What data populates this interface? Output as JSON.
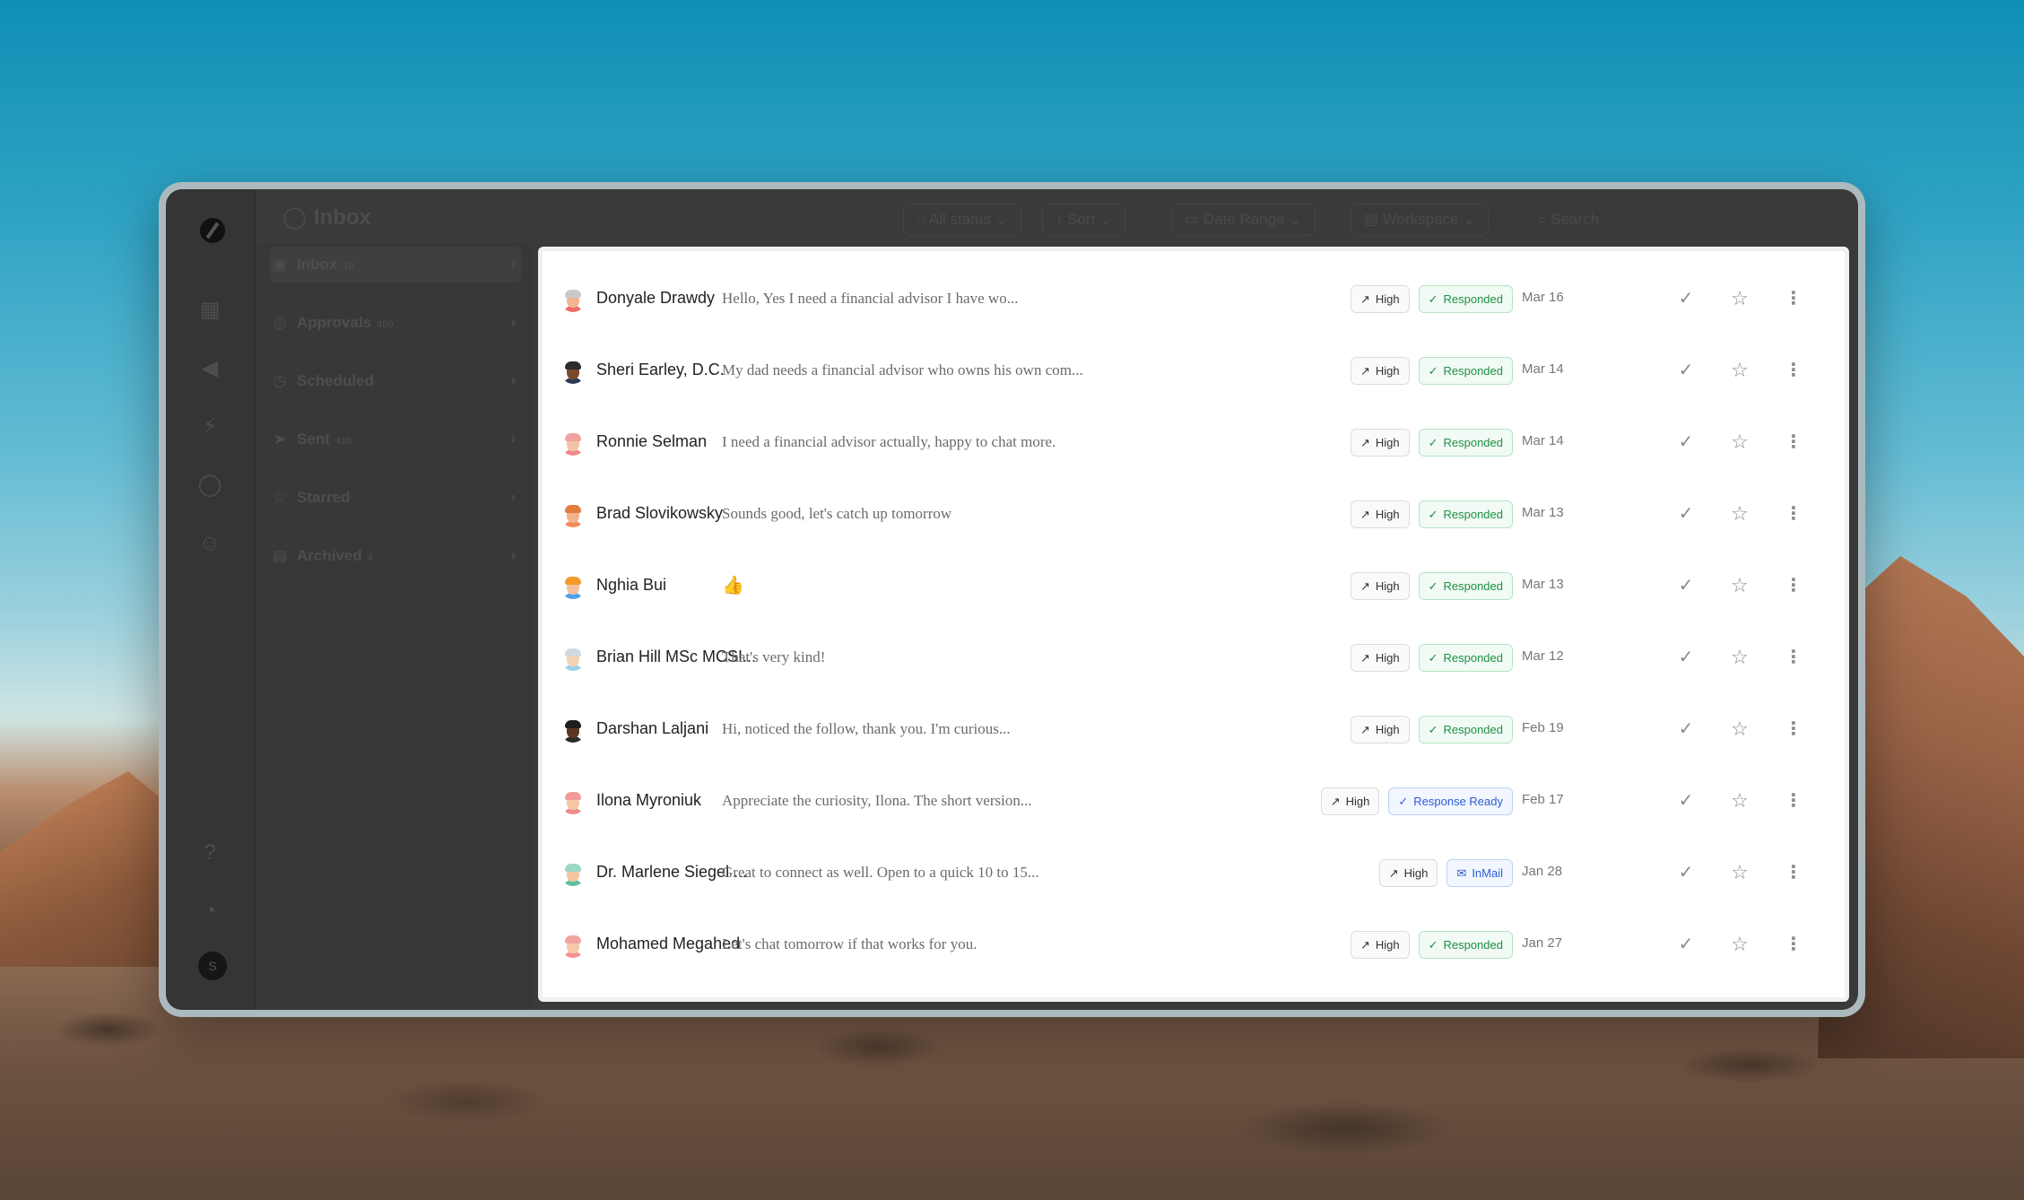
{
  "app": {
    "title": "Inbox"
  },
  "toolbar": {
    "status_filter": "All status",
    "sort_label": "Sort",
    "date_range_label": "Date Range",
    "workspace_label": "Workspace",
    "search_placeholder": "Search"
  },
  "sidebar": {
    "items": [
      {
        "label": "Inbox",
        "count": "10",
        "icon": "inbox-icon"
      },
      {
        "label": "Approvals",
        "count": "450",
        "icon": "approvals-icon"
      },
      {
        "label": "Scheduled",
        "count": "",
        "icon": "clock-icon"
      },
      {
        "label": "Sent",
        "count": "418",
        "icon": "send-icon"
      },
      {
        "label": "Starred",
        "count": "",
        "icon": "star-icon"
      },
      {
        "label": "Archived",
        "count": "4",
        "icon": "archive-icon"
      }
    ]
  },
  "rail": {
    "avatar_initial": "S"
  },
  "messages": [
    {
      "name": "Donyale Drawdy",
      "snippet": "Hello, Yes I need a financial advisor I have wo...",
      "priority": "High",
      "status": "Responded",
      "status_type": "ok",
      "date": "Mar 16"
    },
    {
      "name": "Sheri Earley, D.C.",
      "snippet": "My dad needs a financial advisor who owns his own com...",
      "priority": "High",
      "status": "Responded",
      "status_type": "ok",
      "date": "Mar 14"
    },
    {
      "name": "Ronnie Selman",
      "snippet": "I need a financial advisor actually, happy to chat more.",
      "priority": "High",
      "status": "Responded",
      "status_type": "ok",
      "date": "Mar 14"
    },
    {
      "name": "Brad Slovikowsky",
      "snippet": "Sounds good, let's catch up tomorrow",
      "priority": "High",
      "status": "Responded",
      "status_type": "ok",
      "date": "Mar 13"
    },
    {
      "name": "Nghia Bui",
      "snippet": "👍",
      "priority": "High",
      "status": "Responded",
      "status_type": "ok",
      "date": "Mar 13"
    },
    {
      "name": "Brian Hill MSc MCSI...",
      "snippet": "That's very kind!",
      "priority": "High",
      "status": "Responded",
      "status_type": "ok",
      "date": "Mar 12"
    },
    {
      "name": "Darshan Laljani",
      "snippet": "Hi, noticed the follow, thank you. I'm curious...",
      "priority": "High",
      "status": "Responded",
      "status_type": "ok",
      "date": "Feb 19"
    },
    {
      "name": "Ilona Myroniuk",
      "snippet": "Appreciate the curiosity, Ilona. The short version...",
      "priority": "High",
      "status": "Response Ready",
      "status_type": "ready",
      "date": "Feb 17"
    },
    {
      "name": "Dr. Marlene Siegel ...",
      "snippet": "Great to connect as well. Open to a quick 10 to 15...",
      "priority": "High",
      "status": "InMail",
      "status_type": "inmail",
      "date": "Jan 28"
    },
    {
      "name": "Mohamed Megahed",
      "snippet": "Let's chat tomorrow if that works for you.",
      "priority": "High",
      "status": "Responded",
      "status_type": "ok",
      "date": "Jan 27"
    }
  ],
  "avatars": [
    {
      "skin": "#f1b48f",
      "hair": "#c9c9c9",
      "shirt": "#f06a6a"
    },
    {
      "skin": "#7a4a2c",
      "hair": "#2b2b2b",
      "shirt": "#2b3a55"
    },
    {
      "skin": "#f4c3a3",
      "hair": "#f2a0a0",
      "shirt": "#f08a8a"
    },
    {
      "skin": "#f0b48a",
      "hair": "#e27b3e",
      "shirt": "#f08a5a"
    },
    {
      "skin": "#f3c09c",
      "hair": "#f29b2b",
      "shirt": "#4aa3e8"
    },
    {
      "skin": "#f6d1b3",
      "hair": "#cfd8de",
      "shirt": "#9fd0e8"
    },
    {
      "skin": "#5a3520",
      "hair": "#1e1e1e",
      "shirt": "#2a2a2a"
    },
    {
      "skin": "#f6c6a6",
      "hair": "#f29a9a",
      "shirt": "#f08a8a"
    },
    {
      "skin": "#f3c6a2",
      "hair": "#9ad7c6",
      "shirt": "#5fbfa0"
    },
    {
      "skin": "#f5c8a8",
      "hair": "#f4a3a3",
      "shirt": "#f49090"
    }
  ]
}
